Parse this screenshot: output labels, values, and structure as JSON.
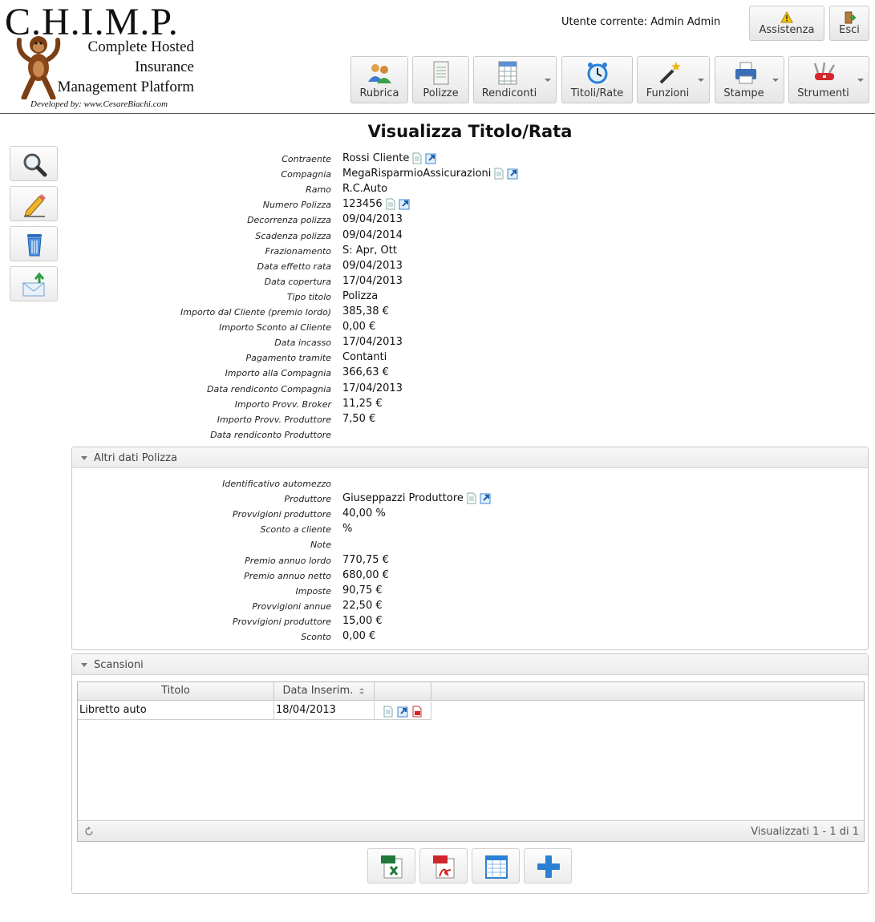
{
  "header": {
    "logo_title": "C.H.I.M.P.",
    "logo_line1": "Complete Hosted",
    "logo_line2": "Insurance",
    "logo_line3": "Management Platform",
    "logo_dev": "Developed by: www.CesareBiachi.com",
    "current_user_label": "Utente corrente: Admin Admin",
    "help_label": "Assistenza",
    "logout_label": "Esci"
  },
  "nav": [
    {
      "label": "Rubrica",
      "icon": "address-book-icon"
    },
    {
      "label": "Polizze",
      "icon": "document-icon"
    },
    {
      "label": "Rendiconti",
      "icon": "spreadsheet-icon",
      "dropdown": true
    },
    {
      "label": "Titoli/Rate",
      "icon": "alarm-clock-icon"
    },
    {
      "label": "Funzioni",
      "icon": "magic-wand-icon",
      "dropdown": true
    },
    {
      "label": "Stampe",
      "icon": "printer-icon",
      "dropdown": true
    },
    {
      "label": "Strumenti",
      "icon": "swiss-knife-icon",
      "dropdown": true
    }
  ],
  "side_actions": [
    "search-icon",
    "edit-pencil-icon",
    "trash-icon",
    "email-send-icon"
  ],
  "page_title": "Visualizza Titolo/Rata",
  "fields": [
    {
      "label": "Contraente",
      "value": "Rossi Cliente",
      "links": true
    },
    {
      "label": "Compagnia",
      "value": "MegaRisparmioAssicurazioni",
      "links": true
    },
    {
      "label": "Ramo",
      "value": "R.C.Auto"
    },
    {
      "label": "Numero Polizza",
      "value": "123456",
      "links": true
    },
    {
      "label": "Decorrenza polizza",
      "value": "09/04/2013"
    },
    {
      "label": "Scadenza polizza",
      "value": "09/04/2014"
    },
    {
      "label": "Frazionamento",
      "value": "S: Apr, Ott"
    },
    {
      "label": "Data effetto rata",
      "value": "09/04/2013"
    },
    {
      "label": "Data copertura",
      "value": "17/04/2013"
    },
    {
      "label": "Tipo titolo",
      "value": "Polizza"
    },
    {
      "label": "Importo dal Cliente (premio lordo)",
      "value": "385,38 €"
    },
    {
      "label": "Importo Sconto al Cliente",
      "value": "0,00 €"
    },
    {
      "label": "Data incasso",
      "value": "17/04/2013"
    },
    {
      "label": "Pagamento tramite",
      "value": "Contanti"
    },
    {
      "label": "Importo alla Compagnia",
      "value": "366,63 €"
    },
    {
      "label": "Data rendiconto Compagnia",
      "value": "17/04/2013"
    },
    {
      "label": "Importo Provv. Broker",
      "value": "11,25 €"
    },
    {
      "label": "Importo Provv. Produttore",
      "value": "7,50 €"
    },
    {
      "label": "Data rendiconto Produttore",
      "value": ""
    }
  ],
  "altri_dati": {
    "title": "Altri dati Polizza",
    "fields": [
      {
        "label": "Identificativo automezzo",
        "value": ""
      },
      {
        "label": "Produttore",
        "value": "Giuseppazzi Produttore",
        "links": true
      },
      {
        "label": "Provvigioni produttore",
        "value": "40,00 %"
      },
      {
        "label": "Sconto a cliente",
        "value": "%"
      },
      {
        "label": "Note",
        "value": ""
      },
      {
        "label": "Premio annuo lordo",
        "value": "770,75 €"
      },
      {
        "label": "Premio annuo netto",
        "value": "680,00 €"
      },
      {
        "label": "Imposte",
        "value": "90,75 €"
      },
      {
        "label": "Provvigioni annue",
        "value": "22,50 €"
      },
      {
        "label": "Provvigioni produttore",
        "value": "15,00 €"
      },
      {
        "label": "Sconto",
        "value": "0,00 €"
      }
    ]
  },
  "scansioni": {
    "title": "Scansioni",
    "columns": [
      "Titolo",
      "Data Inserim."
    ],
    "rows": [
      {
        "titolo": "Libretto auto",
        "data": "18/04/2013"
      }
    ],
    "footer_info": "Visualizzati 1 - 1 di 1",
    "bottom_actions": [
      "excel-export-icon",
      "pdf-export-icon",
      "columns-icon",
      "add-plus-icon"
    ]
  },
  "colors": {
    "accent_blue": "#2b7fd4",
    "border": "#c8c8c8"
  }
}
